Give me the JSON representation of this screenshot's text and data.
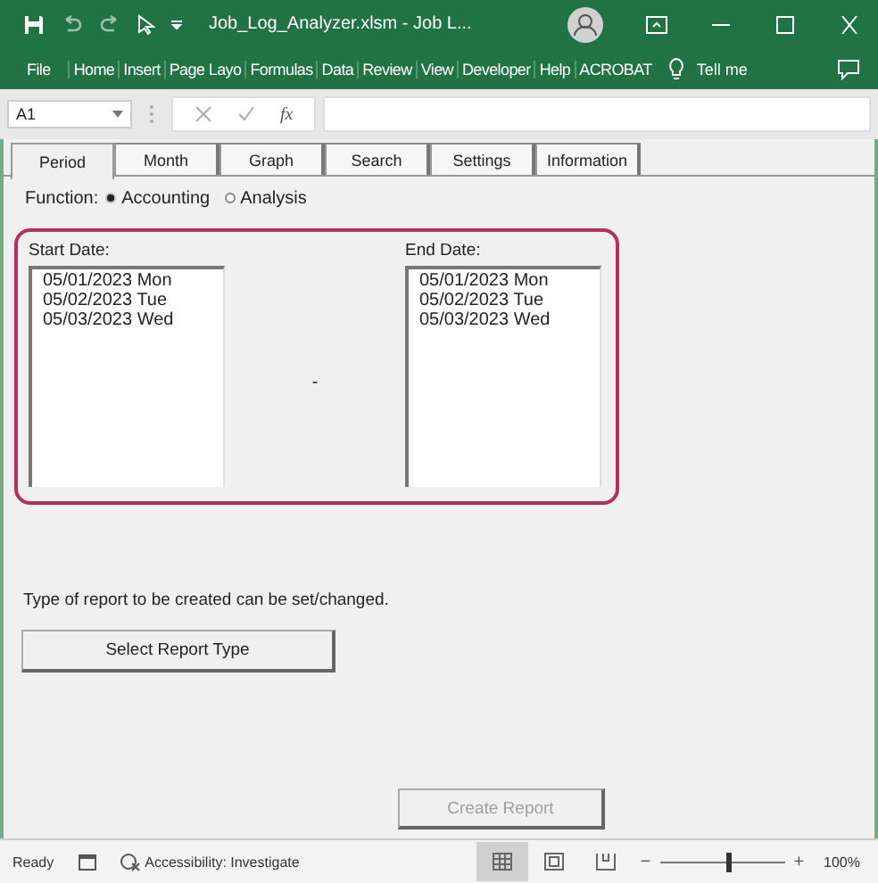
{
  "title_bar": {
    "title": "Job_Log_Analyzer.xlsm  -  Job L..."
  },
  "ribbon": {
    "tabs": [
      "File",
      "Home",
      "Insert",
      "Page Layo",
      "Formulas",
      "Data",
      "Review",
      "View",
      "Developer",
      "Help",
      "ACROBAT"
    ],
    "tell_me": "Tell me"
  },
  "formula_bar": {
    "name_box": "A1",
    "fx": "fx"
  },
  "dialog": {
    "tabs": [
      {
        "label": "Period",
        "selected": true
      },
      {
        "label": "Month",
        "selected": false
      },
      {
        "label": "Graph",
        "selected": false
      },
      {
        "label": "Search",
        "selected": false
      },
      {
        "label": "Settings",
        "selected": false
      },
      {
        "label": "Information",
        "selected": false
      }
    ],
    "function_label": "Function:",
    "function_options": [
      {
        "label": "Accounting",
        "selected": true
      },
      {
        "label": "Analysis",
        "selected": false
      }
    ],
    "start_date": {
      "label": "Start Date:",
      "items": [
        "05/01/2023 Mon",
        "05/02/2023 Tue",
        "05/03/2023 Wed"
      ]
    },
    "separator": "-",
    "end_date": {
      "label": "End Date:",
      "items": [
        "05/01/2023 Mon",
        "05/02/2023 Tue",
        "05/03/2023 Wed"
      ]
    },
    "report_note": "Type of report to be created can be set/changed.",
    "select_button": {
      "label": "Select Report Type",
      "disabled": false
    },
    "create_button": {
      "label": "Create Report",
      "disabled": true
    }
  },
  "status_bar": {
    "status": "Ready",
    "accessibility": "Accessibility: Investigate",
    "views": [
      {
        "kind": "normal",
        "selected": true
      },
      {
        "kind": "page-layout",
        "selected": false
      },
      {
        "kind": "page-break",
        "selected": false
      }
    ],
    "zoom": {
      "level": 0.55,
      "minus": "−",
      "plus": "+",
      "reading": "100%"
    }
  }
}
